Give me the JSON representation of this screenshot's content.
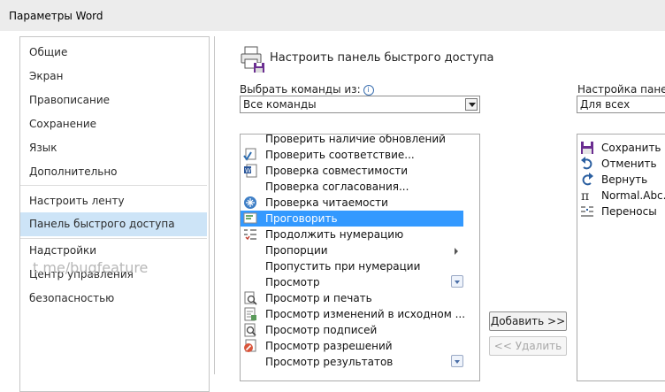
{
  "window": {
    "title": "Параметры Word"
  },
  "sidebar": {
    "items": [
      {
        "label": "Общие"
      },
      {
        "label": "Экран"
      },
      {
        "label": "Правописание"
      },
      {
        "label": "Сохранение"
      },
      {
        "label": "Язык"
      },
      {
        "label": "Дополнительно"
      },
      {
        "label": "Настроить ленту"
      },
      {
        "label": "Панель быстрого доступа",
        "selected": true
      },
      {
        "label": "Надстройки"
      },
      {
        "label": "Центр управления безопасностью"
      }
    ],
    "watermark": "t.me/bugfeature"
  },
  "main": {
    "header_title": "Настроить панель быстрого доступа",
    "choose_label": "Выбрать команды из:",
    "choose_value": "Все команды",
    "commands": [
      {
        "label": "Проверить наличие обновлений",
        "icon": "none"
      },
      {
        "label": "Проверить соответствие...",
        "icon": "check-compliance-icon"
      },
      {
        "label": "Проверка совместимости",
        "icon": "word-doc-icon"
      },
      {
        "label": "Проверка согласования...",
        "icon": "none"
      },
      {
        "label": "Проверка читаемости",
        "icon": "readability-icon"
      },
      {
        "label": "Проговорить",
        "icon": "speak-icon",
        "selected": true
      },
      {
        "label": "Продолжить нумерацию",
        "icon": "numbering-icon"
      },
      {
        "label": "Пропорции",
        "icon": "none",
        "submenu": true
      },
      {
        "label": "Пропустить при нумерации",
        "icon": "none"
      },
      {
        "label": "Просмотр",
        "icon": "none",
        "dropdown": true
      },
      {
        "label": "Просмотр и печать",
        "icon": "print-preview-icon"
      },
      {
        "label": "Просмотр изменений в исходном ...",
        "icon": "changes-icon"
      },
      {
        "label": "Просмотр подписей",
        "icon": "signature-icon"
      },
      {
        "label": "Просмотр разрешений",
        "icon": "permissions-icon"
      },
      {
        "label": "Просмотр результатов",
        "icon": "none",
        "dropdown": true
      }
    ],
    "add_button": "Добавить >>",
    "remove_button": "<< Удалить",
    "qat_label": "Настройка панели",
    "qat_value": "Для всех документ",
    "qat_items": [
      {
        "label": "Сохранить",
        "icon": "save-icon"
      },
      {
        "label": "Отменить",
        "icon": "undo-icon"
      },
      {
        "label": "Вернуть",
        "icon": "redo-icon"
      },
      {
        "label": "Normal.Abc.M",
        "icon": "pi-icon"
      },
      {
        "label": "Переносы",
        "icon": "hyphenation-icon"
      }
    ]
  }
}
